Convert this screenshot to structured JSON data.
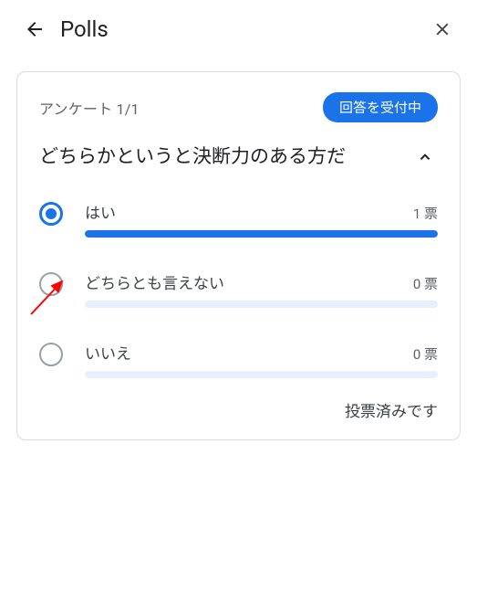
{
  "header": {
    "title": "Polls"
  },
  "card": {
    "counter": "アンケート 1/1",
    "badge": "回答を受付中",
    "question": "どちらかというと決断力のある方だ",
    "options": [
      {
        "label": "はい",
        "count_label": "1 票",
        "percent": 100,
        "selected": true
      },
      {
        "label": "どちらとも言えない",
        "count_label": "0 票",
        "percent": 0,
        "selected": false
      },
      {
        "label": "いいえ",
        "count_label": "0 票",
        "percent": 0,
        "selected": false
      }
    ],
    "footer": "投票済みです"
  }
}
